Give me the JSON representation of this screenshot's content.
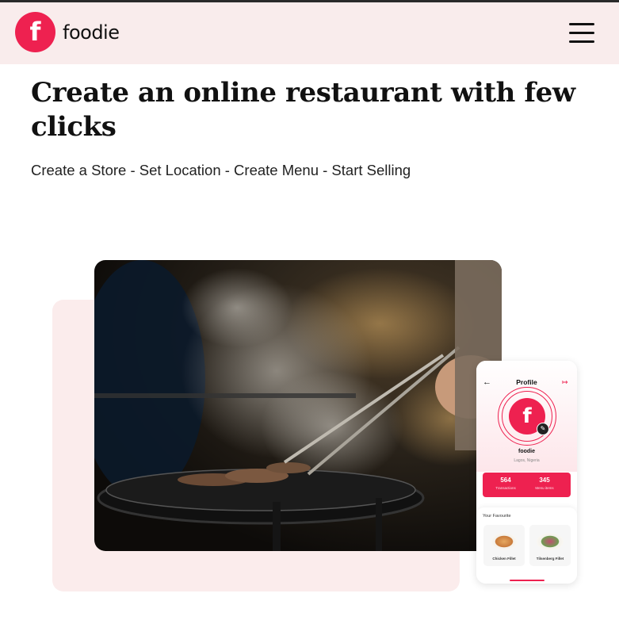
{
  "header": {
    "logo_letter": "f",
    "brand_name": "foodie",
    "menu_icon": "hamburger-menu-icon"
  },
  "hero": {
    "title": "Create an online restaurant with few clicks",
    "subtitle": "Create a Store - Set Location - Create Menu - Start Selling"
  },
  "phone": {
    "title": "Profile",
    "back_icon": "←",
    "logout_icon": "↦",
    "avatar_letter": "f",
    "edit_icon": "✎",
    "name": "foodie",
    "location": "Lagos, Nigeria",
    "stats": [
      {
        "value": "564",
        "label": "Transactions"
      },
      {
        "value": "345",
        "label": "Menu items"
      }
    ],
    "favourites_title": "Your Favourite",
    "favourites": [
      {
        "label": "Chicken Fillet"
      },
      {
        "label": "Tilsenberg Fillet"
      }
    ]
  },
  "colors": {
    "accent": "#ee2150",
    "header_bg": "#f9ecec",
    "card_bg": "#fbecec"
  }
}
